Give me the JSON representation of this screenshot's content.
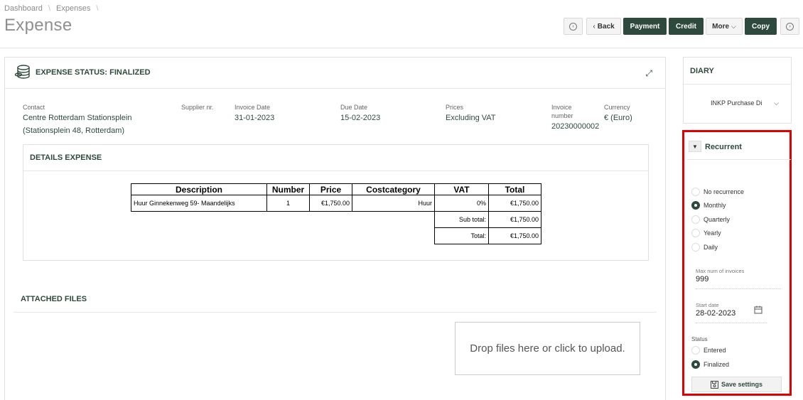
{
  "breadcrumb": {
    "items": [
      "Dashboard",
      "Expenses"
    ]
  },
  "page": {
    "title": "Expense"
  },
  "toolbar": {
    "back": "Back",
    "payment": "Payment",
    "credit": "Credit",
    "more": "More",
    "copy": "Copy",
    "prev_icon": "‹",
    "next_icon": "›"
  },
  "status": {
    "title": "EXPENSE STATUS: FINALIZED"
  },
  "invoice": {
    "contact_label": "Contact",
    "contact_line1": "Centre Rotterdam Stationsplein",
    "contact_line2": "(Stationsplein 48, Rotterdam)",
    "supplier_label": "Supplier nr.",
    "invoice_date_label": "Invoice Date",
    "invoice_date": "31-01-2023",
    "due_date_label": "Due Date",
    "due_date": "15-02-2023",
    "prices_label": "Prices",
    "prices": "Excluding VAT",
    "invoice_number_label_1": "Invoice",
    "invoice_number_label_2": "number",
    "invoice_number": "20230000002",
    "currency_label": "Currency",
    "currency": "€ (Euro)"
  },
  "details": {
    "title": "DETAILS EXPENSE",
    "headers": [
      "Description",
      "Number",
      "Price",
      "Costcategory",
      "VAT",
      "Total"
    ],
    "row": {
      "description": "Huur Ginnekenweg 59- Maandelijks",
      "number": "1",
      "price": "€1,750.00",
      "costcategory": "Huur",
      "vat": "0%",
      "total": "€1,750.00"
    },
    "subtotal_label": "Sub total:",
    "subtotal": "€1,750.00",
    "total_label": "Total:",
    "total": "€1,750.00"
  },
  "attached": {
    "title": "ATTACHED FILES",
    "dropzone": "Drop files here or click to upload."
  },
  "diary": {
    "title": "DIARY",
    "selected": "INKP Purchase Di"
  },
  "recurrent": {
    "title": "Recurrent",
    "options": [
      "No recurrence",
      "Monthly",
      "Quarterly",
      "Yearly",
      "Daily"
    ],
    "selected": "Monthly",
    "max_label": "Max num of invoices",
    "max_value": "999",
    "start_label": "Start date",
    "start_value": "28-02-2023",
    "status_label": "Status",
    "status_options": [
      "Entered",
      "Finalized"
    ],
    "status_selected": "Finalized",
    "save": "Save settings"
  },
  "colors": {
    "accent": "#2d4a3c",
    "highlight": "#e00000"
  }
}
